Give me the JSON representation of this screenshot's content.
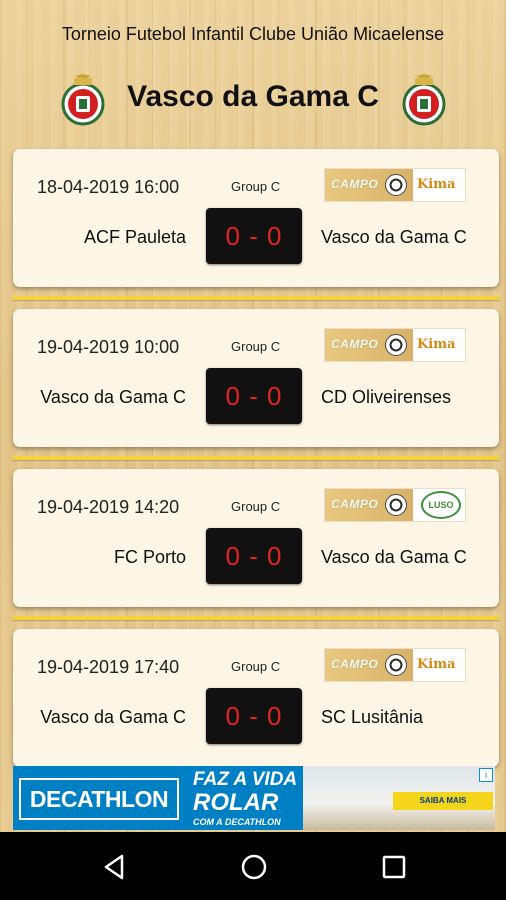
{
  "header": {
    "title": "Torneio Futebol Infantil Clube União Micaelense",
    "team": "Vasco da Gama C"
  },
  "matches": [
    {
      "datetime": "18-04-2019 16:00",
      "group": "Group C",
      "home": "ACF Pauleta",
      "away": "Vasco da Gama C",
      "score": "0 - 0",
      "sponsor": {
        "venue": "CAMPO",
        "brand": "Kima"
      }
    },
    {
      "datetime": "19-04-2019 10:00",
      "group": "Group C",
      "home": "Vasco da Gama C",
      "away": "CD Oliveirenses",
      "score": "0 - 0",
      "sponsor": {
        "venue": "CAMPO",
        "brand": "Kima"
      }
    },
    {
      "datetime": "19-04-2019 14:20",
      "group": "Group C",
      "home": "FC Porto",
      "away": "Vasco da Gama C",
      "score": "0 - 0",
      "sponsor": {
        "venue": "CAMPO",
        "brand": "LUSO"
      }
    },
    {
      "datetime": "19-04-2019 17:40",
      "group": "Group C",
      "home": "Vasco da Gama C",
      "away": "SC Lusitânia",
      "score": "0 - 0",
      "sponsor": {
        "venue": "CAMPO",
        "brand": "Kima"
      }
    }
  ],
  "ad": {
    "brand": "DECATHLON",
    "line1": "FAZ A VIDA",
    "line2": "ROLAR",
    "line3": "COM A DECATHLON",
    "cta": "SAIBA MAIS",
    "info": "i"
  },
  "colors": {
    "score_bg": "#111111",
    "score_text": "#e0261f",
    "divider": "#f4d23d",
    "ad_blue": "#0080c4"
  },
  "icons": {
    "crest": "club-crest-icon",
    "back": "back-icon",
    "home": "home-icon",
    "recents": "recents-icon"
  }
}
